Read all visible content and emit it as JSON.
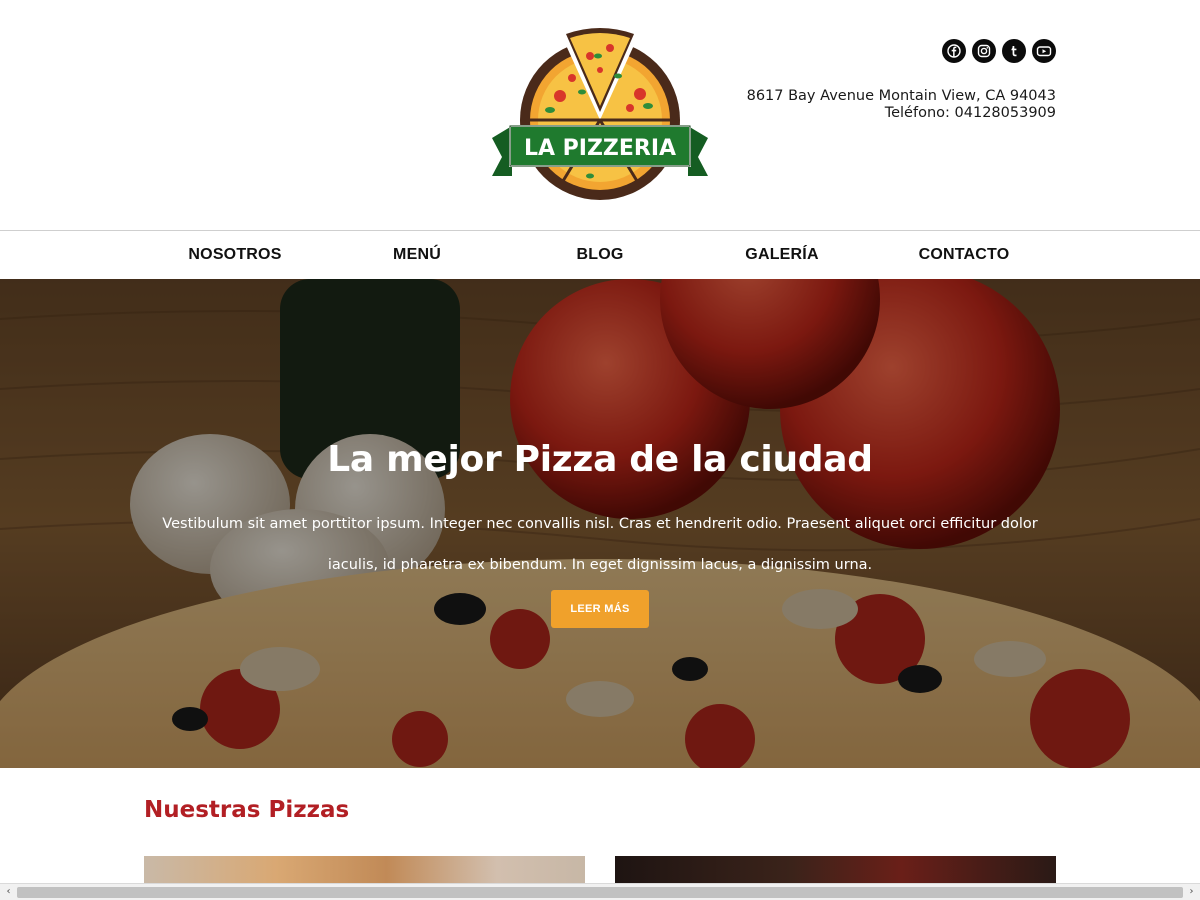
{
  "brand": {
    "logo_text": "LA PIZZERIA",
    "colors": {
      "green": "#1f7a2e",
      "brown": "#4a2a1a",
      "crust": "#f2a531",
      "red": "#d8352a"
    }
  },
  "social": [
    {
      "name": "facebook-icon"
    },
    {
      "name": "instagram-icon"
    },
    {
      "name": "tumblr-icon"
    },
    {
      "name": "youtube-icon"
    }
  ],
  "contact": {
    "address": "8617 Bay Avenue Montain View, CA 94043",
    "phone": "Teléfono: 04128053909"
  },
  "nav": {
    "items": [
      {
        "label": "NOSOTROS"
      },
      {
        "label": "MENÚ"
      },
      {
        "label": "BLOG"
      },
      {
        "label": "GALERÍA"
      },
      {
        "label": "CONTACTO"
      }
    ]
  },
  "hero": {
    "title": "La mejor Pizza de la ciudad",
    "text": "Vestibulum sit amet porttitor ipsum. Integer nec convallis nisl. Cras et hendrerit odio. Praesent aliquet orci efficitur dolor iaculis, id pharetra ex bibendum. In eget dignissim lacus, a dignissim urna.",
    "button_label": "LEER MÁS",
    "button_color": "#f0a12b"
  },
  "section": {
    "title": "Nuestras Pizzas",
    "title_color": "#b21f24"
  },
  "scrollbar": {
    "left_arrow": "‹",
    "right_arrow": "›"
  }
}
